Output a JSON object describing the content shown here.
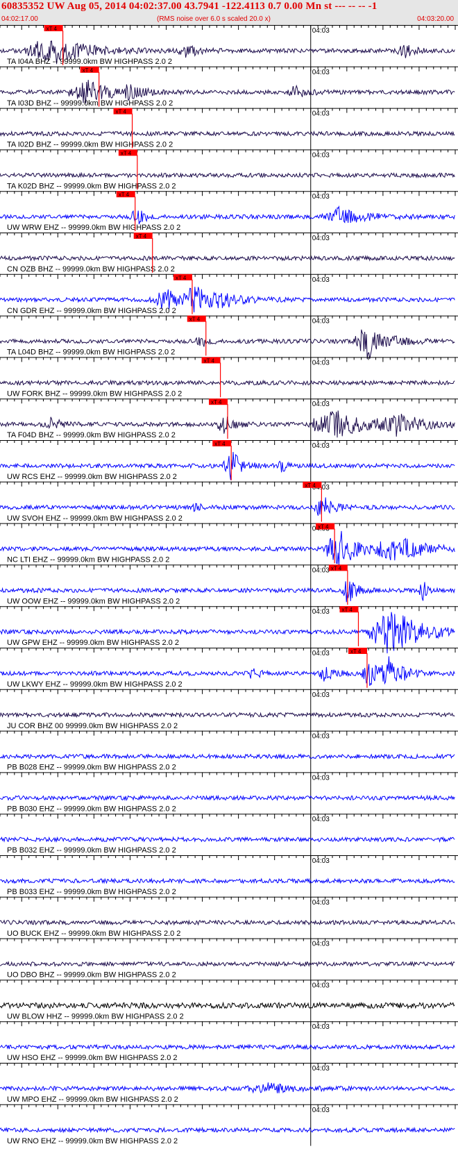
{
  "header": {
    "title": "60835352 UW Aug 05, 2014 04:02:37.00   43.7941 -122.4113  0.7 0.00 Mn st --- -- --  -1",
    "start_time": "04:02:17.00",
    "rms_note": "(RMS noise over 6.0 s scaled 20.0 x)",
    "end_time": "04:03:20.00"
  },
  "colors": {
    "trace_blue": "#0000ff",
    "trace_dark": "#1a0a4a",
    "trace_black": "#000000",
    "pick_red": "#ff0000",
    "header_red": "#e00000"
  },
  "chart_data": {
    "type": "line",
    "x_start": "04:02:17.00",
    "x_end": "04:03:20.00",
    "minute_label": "04:03",
    "pick_label": "xT 4",
    "traces": [
      {
        "label": "TA I04A BHZ -- 99999.0km BW  HIGHPASS  2.0  2",
        "color": "dark",
        "pick_s": 8.7,
        "events": [
          {
            "t": 7,
            "a": 20,
            "w": 7
          },
          {
            "t": 26,
            "a": 8,
            "w": 3
          },
          {
            "t": 56,
            "a": 9,
            "w": 2
          }
        ]
      },
      {
        "label": "TA I03D BHZ -- 99999.0km BW  HIGHPASS  2.0  2",
        "color": "dark",
        "pick_s": 13.7,
        "events": [
          {
            "t": 12,
            "a": 16,
            "w": 5
          },
          {
            "t": 18,
            "a": 10,
            "w": 2
          },
          {
            "t": 41,
            "a": 10,
            "w": 2
          }
        ]
      },
      {
        "label": "TA I02D BHZ -- 99999.0km BW  HIGHPASS  2.0  2",
        "color": "dark",
        "pick_s": 18.3,
        "events": []
      },
      {
        "label": "TA K02D BHZ -- 99999.0km BW  HIGHPASS  2.0  2",
        "color": "dark",
        "pick_s": 19.0,
        "events": []
      },
      {
        "label": "UW WRW EHZ -- 99999.0km BW  HIGHPASS  2.0  2",
        "color": "blue",
        "pick_s": 18.7,
        "events": [
          {
            "t": 19,
            "a": 10,
            "w": 2
          },
          {
            "t": 47,
            "a": 12,
            "w": 5
          }
        ]
      },
      {
        "label": "CN OZB BHZ -- 99999.0km BW  HIGHPASS  2.0  2",
        "color": "dark",
        "pick_s": 21.1,
        "events": []
      },
      {
        "label": "CN GDR EHZ -- 99999.0km BW  HIGHPASS  2.0  2",
        "color": "blue",
        "pick_s": 26.6,
        "events": [
          {
            "t": 23,
            "a": 14,
            "w": 4
          },
          {
            "t": 27,
            "a": 18,
            "w": 3
          },
          {
            "t": 31,
            "a": 9,
            "w": 4
          }
        ]
      },
      {
        "label": "TA L04D BHZ -- 99999.0km BW  HIGHPASS  2.0  2",
        "color": "dark",
        "pick_s": 28.5,
        "events": [
          {
            "t": 28,
            "a": 6,
            "w": 2
          },
          {
            "t": 51,
            "a": 25,
            "w": 4
          }
        ]
      },
      {
        "label": "UW FORK BHZ -- 99999.0km BW  HIGHPASS  2.0  2",
        "color": "dark",
        "pick_s": 30.5,
        "events": []
      },
      {
        "label": "TA F04D BHZ -- 99999.0km BW  HIGHPASS  2.0  2",
        "color": "dark",
        "pick_s": 31.5,
        "events": [
          {
            "t": 7,
            "a": 9,
            "w": 2
          },
          {
            "t": 31,
            "a": 12,
            "w": 2
          },
          {
            "t": 46,
            "a": 22,
            "w": 6
          },
          {
            "t": 55,
            "a": 14,
            "w": 6
          }
        ]
      },
      {
        "label": "UW RCS EHZ -- 99999.0km BW  HIGHPASS  2.0  2",
        "color": "blue",
        "pick_s": 32.0,
        "events": [
          {
            "t": 32,
            "a": 22,
            "w": 2
          },
          {
            "t": 39,
            "a": 10,
            "w": 1
          }
        ]
      },
      {
        "label": "UW SVOH EHZ -- 99999.0km BW  HIGHPASS  2.0  2",
        "color": "blue",
        "pick_s": 44.5,
        "events": [
          {
            "t": 27,
            "a": 8,
            "w": 1
          },
          {
            "t": 44.6,
            "a": 18,
            "w": 2
          }
        ]
      },
      {
        "label": "NC LTI EHZ -- 99999.0km BW  HIGHPASS  2.0  2",
        "color": "blue",
        "pick_s": 46.3,
        "events": [
          {
            "t": 47,
            "a": 28,
            "w": 4
          },
          {
            "t": 55,
            "a": 16,
            "w": 6
          }
        ]
      },
      {
        "label": "UW OOW EHZ -- 99999.0km BW  HIGHPASS  2.0  2",
        "color": "blue",
        "pick_s": 48.1,
        "events": [
          {
            "t": 48.2,
            "a": 20,
            "w": 1.5
          },
          {
            "t": 58.5,
            "a": 14,
            "w": 1
          }
        ]
      },
      {
        "label": "UW GPW EHZ -- 99999.0km BW  HIGHPASS  2.0  2",
        "color": "blue",
        "pick_s": 49.6,
        "events": [
          {
            "t": 54,
            "a": 34,
            "w": 6
          }
        ]
      },
      {
        "label": "UW LKWY EHZ -- 99999.0km BW  HIGHPASS  2.0  2",
        "color": "blue",
        "pick_s": 50.8,
        "events": [
          {
            "t": 35,
            "a": 14,
            "w": 1
          },
          {
            "t": 45,
            "a": 10,
            "w": 2
          },
          {
            "t": 51,
            "a": 18,
            "w": 2
          },
          {
            "t": 54,
            "a": 22,
            "w": 3
          }
        ]
      },
      {
        "label": "JU COR BHZ 00 99999.0km BW  HIGHPASS  2.0  2",
        "color": "dark",
        "pick_s": null,
        "events": []
      },
      {
        "label": "PB B028 EHZ -- 99999.0km BW  HIGHPASS  2.0  2",
        "color": "blue",
        "pick_s": null,
        "events": []
      },
      {
        "label": "PB B030 EHZ -- 99999.0km BW  HIGHPASS  2.0  2",
        "color": "blue",
        "pick_s": null,
        "events": []
      },
      {
        "label": "PB B032 EHZ -- 99999.0km BW  HIGHPASS  2.0  2",
        "color": "blue",
        "pick_s": null,
        "events": []
      },
      {
        "label": "PB B033 EHZ -- 99999.0km BW  HIGHPASS  2.0  2",
        "color": "blue",
        "pick_s": null,
        "events": []
      },
      {
        "label": "UO BUCK EHZ -- 99999.0km BW  HIGHPASS  2.0  2",
        "color": "dark",
        "pick_s": null,
        "events": []
      },
      {
        "label": "UO DBO BHZ -- 99999.0km BW  HIGHPASS  2.0  2",
        "color": "dark",
        "pick_s": null,
        "events": []
      },
      {
        "label": "UW BLOW HHZ -- 99999.0km BW  HIGHPASS  2.0  2",
        "color": "black",
        "pick_s": null,
        "events": []
      },
      {
        "label": "UW HSO EHZ -- 99999.0km BW  HIGHPASS  2.0  2",
        "color": "blue",
        "pick_s": null,
        "events": []
      },
      {
        "label": "UW MPO EHZ -- 99999.0km BW  HIGHPASS  2.0  2",
        "color": "blue",
        "pick_s": null,
        "events": [
          {
            "t": 37,
            "a": 6,
            "w": 6
          }
        ]
      },
      {
        "label": "UW RNO EHZ -- 99999.0km BW  HIGHPASS  2.0  2",
        "color": "blue",
        "pick_s": null,
        "events": []
      }
    ]
  }
}
